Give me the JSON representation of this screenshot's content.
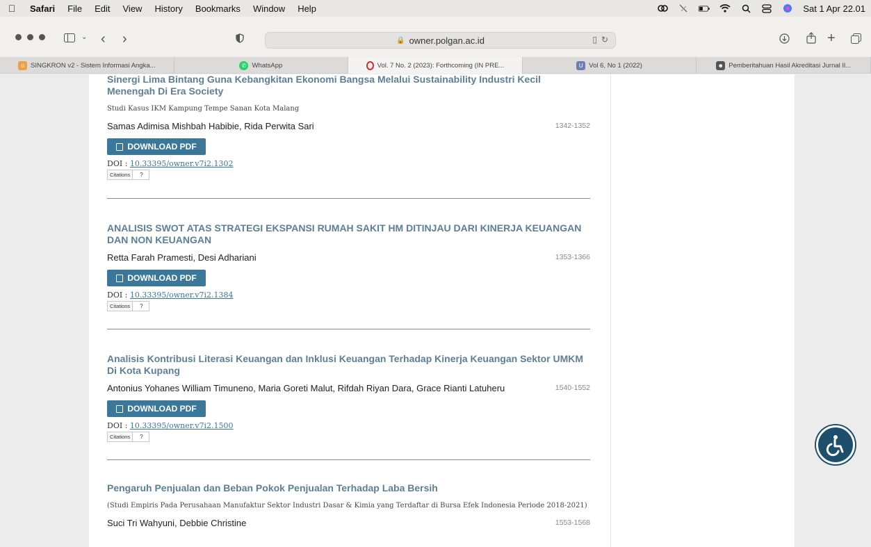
{
  "menubar": {
    "app": "Safari",
    "items": [
      "File",
      "Edit",
      "View",
      "History",
      "Bookmarks",
      "Window",
      "Help"
    ],
    "clock": "Sat 1 Apr  22.01"
  },
  "toolbar": {
    "address": "owner.polgan.ac.id"
  },
  "tabs": [
    {
      "label": "SINGKRON v2 - Sistem Informasi Angka...",
      "icon": "smiley-icon",
      "color": "#e7a24a"
    },
    {
      "label": "WhatsApp",
      "icon": "whatsapp-icon",
      "color": "#25d366"
    },
    {
      "label": "Vol. 7 No. 2 (2023): Forthcoming (IN PRE...",
      "icon": "opera-icon",
      "color": "#d32f2f",
      "active": true
    },
    {
      "label": "Vol 6, No 1 (2022)",
      "icon": "u-icon",
      "color": "#6d7fb1"
    },
    {
      "label": "Pemberitahuan Hasil Akreditasi Jurnal Il...",
      "icon": "avatar-icon",
      "color": "#555555"
    }
  ],
  "articles": [
    {
      "title": "Sinergi Lima Bintang Guna Kebangkitan Ekonomi Bangsa Melalui Sustainability Industri Kecil Menengah Di Era Society",
      "subtitle": "Studi Kasus IKM Kampung Tempe Sanan Kota Malang",
      "authors": "Samas Adimisa Mishbah Habibie, Rida Perwita Sari",
      "pages": "1342-1352",
      "pdf_label": "DOWNLOAD PDF",
      "doi_prefix": "DOI : ",
      "doi": "10.33395/owner.v7i2.1302",
      "citations_label": "Citations",
      "citations_count": "?"
    },
    {
      "title": "ANALISIS SWOT ATAS STRATEGI EKSPANSI RUMAH SAKIT HM DITINJAU DARI KINERJA KEUANGAN DAN NON KEUANGAN",
      "authors": "Retta Farah Pramesti, Desi Adhariani",
      "pages": "1353-1366",
      "pdf_label": "DOWNLOAD PDF",
      "doi_prefix": "DOI : ",
      "doi": "10.33395/owner.v7i2.1384",
      "citations_label": "Citations",
      "citations_count": "?"
    },
    {
      "title": "Analisis Kontribusi Literasi Keuangan dan Inklusi Keuangan Terhadap Kinerja Keuangan Sektor UMKM Di Kota Kupang",
      "authors": "Antonius Yohanes William Timuneno, Maria Goreti Malut, Rifdah Riyan Dara, Grace Rianti Latuheru",
      "pages": "1540-1552",
      "pdf_label": "DOWNLOAD PDF",
      "doi_prefix": "DOI : ",
      "doi": "10.33395/owner.v7i2.1500",
      "citations_label": "Citations",
      "citations_count": "?"
    },
    {
      "title": "Pengaruh Penjualan dan Beban Pokok Penjualan Terhadap Laba Bersih",
      "subtitle": "(Studi Empiris Pada Perusahaan Manufaktur Sektor Industri Dasar & Kimia yang Terdaftar di Bursa Efek Indonesia Periode 2018-2021)",
      "authors": "Suci Tri Wahyuni, Debbie Christine",
      "pages": "1553-1568"
    }
  ],
  "colors": {
    "accent": "#3a7799",
    "title": "#5d7f94"
  }
}
